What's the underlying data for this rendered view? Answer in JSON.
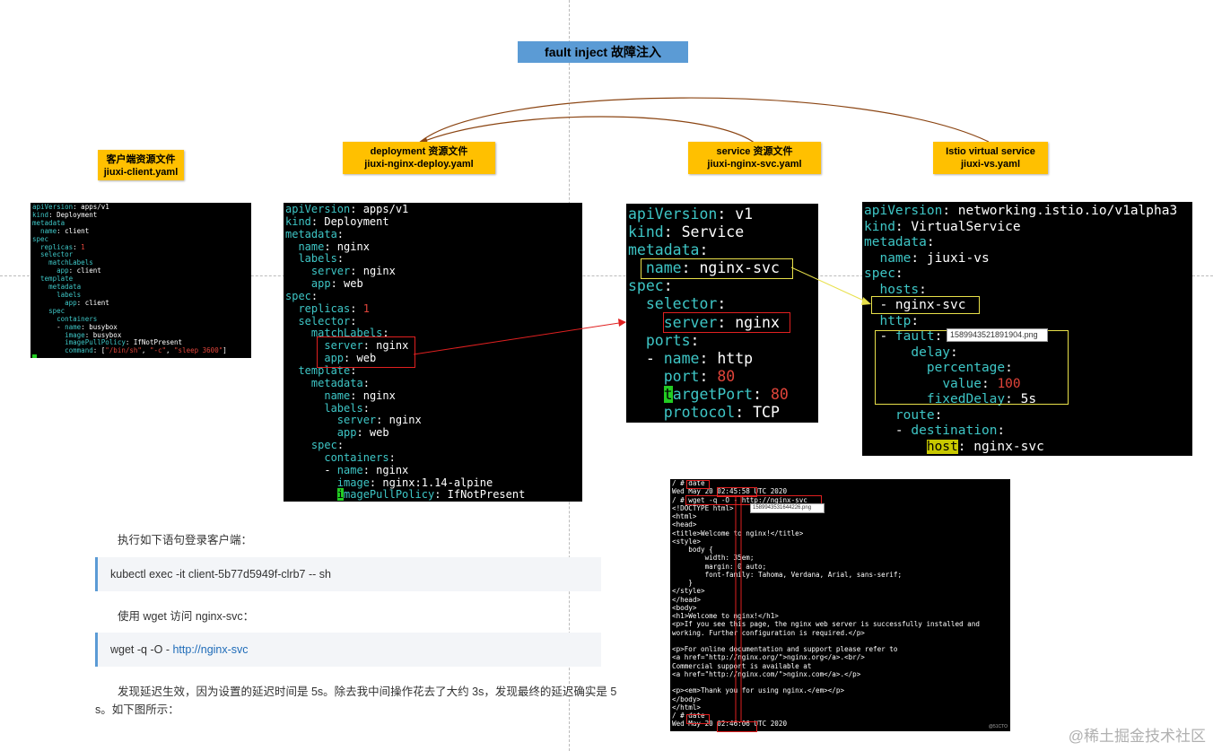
{
  "title": "fault inject 故障注入",
  "labels": {
    "client": {
      "line1": "客户端资源文件",
      "line2": "jiuxi-client.yaml"
    },
    "deploy": {
      "line1": "deployment 资源文件",
      "line2": "jiuxi-nginx-deploy.yaml"
    },
    "svc": {
      "line1": "service 资源文件",
      "line2": "jiuxi-nginx-svc.yaml"
    },
    "vs": {
      "line1": "Istio virtual service",
      "line2": "jiuxi-vs.yaml"
    }
  },
  "client_yaml": [
    "apiVersion: apps/v1",
    "kind: Deployment",
    "metadata",
    "  name: client",
    "spec",
    "  replicas: 1",
    "  selector",
    "    matchLabels",
    "      app: client",
    "  template",
    "    metadata",
    "      labels",
    "        app: client",
    "    spec",
    "      containers",
    "      - name: busybox",
    "        image: busybox",
    "        imagePullPolicy: IfNotPresent",
    "        command: [\"/bin/sh\", \"-c\", \"sleep 3600\"]"
  ],
  "tooltips": {
    "vs_fault": "1589943521891904.png",
    "terminal_wget": "1589943531644226.png"
  },
  "doc": {
    "p1": "执行如下语句登录客户端：",
    "cmd1": "kubectl exec -it client-5b77d5949f-clrb7 -- sh",
    "p2": "使用 wget 访问 nginx-svc：",
    "cmd2_prefix": "wget -q -O - ",
    "cmd2_link": "http://nginx-svc",
    "p3_line1": "发现延迟生效，因为设置的延迟时间是 5s。除去我中间操作花去了大约 3s，发现最终的延迟确实是 5",
    "p3_line2": "s。如下图所示："
  },
  "terminal_lines": [
    "/ # date",
    "Wed May 20 02:45:58 UTC 2020",
    "/ # wget -q -O - http://nginx-svc",
    "<!DOCTYPE html>",
    "<html>",
    "<head>",
    "<title>Welcome to nginx!</title>",
    "<style>",
    "    body {",
    "        width: 35em;",
    "        margin: 0 auto;",
    "        font-family: Tahoma, Verdana, Arial, sans-serif;",
    "    }",
    "</style>",
    "</head>",
    "<body>",
    "<h1>Welcome to nginx!</h1>",
    "<p>If you see this page, the nginx web server is successfully installed and",
    "working. Further configuration is required.</p>",
    "",
    "<p>For online documentation and support please refer to",
    "<a href=\"http://nginx.org/\">nginx.org</a>.<br/>",
    "Commercial support is available at",
    "<a href=\"http://nginx.com/\">nginx.com</a>.</p>",
    "",
    "<p><em>Thank you for using nginx.</em></p>",
    "</body>",
    "</html>",
    "/ # date",
    "Wed May 20 02:46:06 UTC 2020"
  ],
  "terminal_corner": "@51CTO",
  "watermark": "@稀土掘金技术社区"
}
